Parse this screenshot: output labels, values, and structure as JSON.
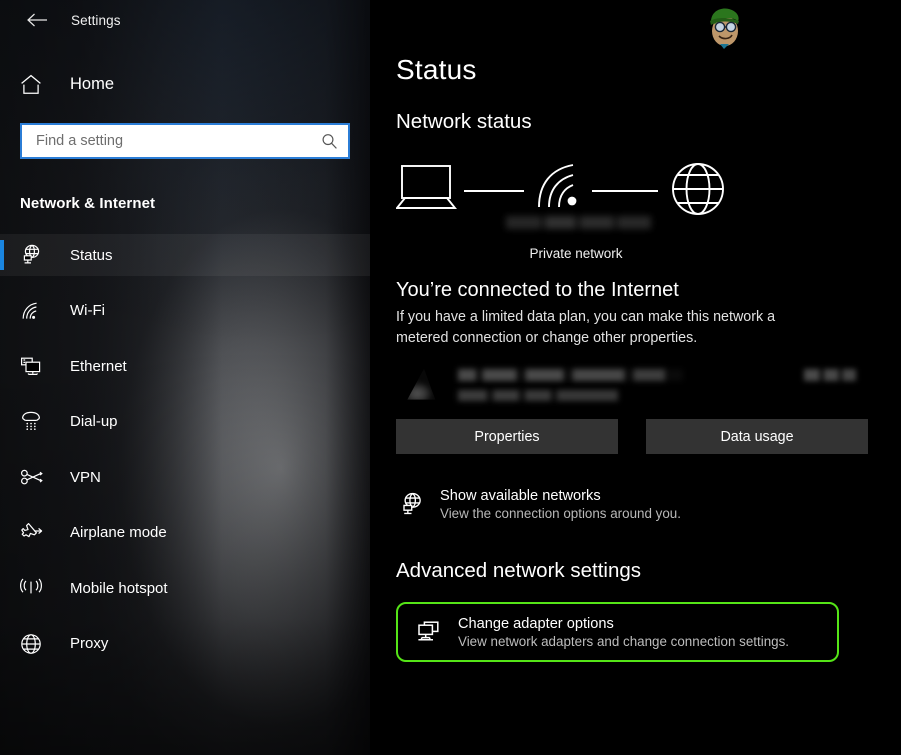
{
  "window": {
    "title": "Settings",
    "back_icon": "back-arrow-icon"
  },
  "sidebar": {
    "home_label": "Home",
    "home_icon": "home-icon",
    "search": {
      "placeholder": "Find a setting",
      "value": "",
      "icon": "search-icon"
    },
    "section_header": "Network & Internet",
    "items": [
      {
        "label": "Status",
        "icon": "network-status-icon",
        "selected": true
      },
      {
        "label": "Wi-Fi",
        "icon": "wifi-icon",
        "selected": false
      },
      {
        "label": "Ethernet",
        "icon": "ethernet-icon",
        "selected": false
      },
      {
        "label": "Dial-up",
        "icon": "dialup-phone-icon",
        "selected": false
      },
      {
        "label": "VPN",
        "icon": "vpn-icon",
        "selected": false
      },
      {
        "label": "Airplane mode",
        "icon": "airplane-icon",
        "selected": false
      },
      {
        "label": "Mobile hotspot",
        "icon": "hotspot-icon",
        "selected": false
      },
      {
        "label": "Proxy",
        "icon": "globe-icon",
        "selected": false
      }
    ]
  },
  "main": {
    "page_title": "Status",
    "network_status_heading": "Network status",
    "diagram": {
      "device_icon": "laptop-icon",
      "router_icon": "wifi-signal-icon",
      "internet_icon": "globe-icon",
      "ssid_label": "",
      "network_type_label": "Private network"
    },
    "connection": {
      "title": "You’re connected to the Internet",
      "description": "If you have a limited data plan, you can make this network a metered connection or change other properties.",
      "network_name": "",
      "network_period": "",
      "data_used": ""
    },
    "buttons": {
      "properties": "Properties",
      "data_usage": "Data usage"
    },
    "show_networks": {
      "icon": "network-status-icon",
      "title": "Show available networks",
      "subtitle": "View the connection options around you."
    },
    "advanced_heading": "Advanced network settings",
    "adapter_options": {
      "icon": "adapter-monitor-icon",
      "title": "Change adapter options",
      "subtitle": "View network adapters and change connection settings.",
      "highlight_color": "#55e417"
    }
  },
  "colors": {
    "accent_blue": "#1a85e0",
    "search_border": "#2b7dd6",
    "button_bg": "#333333",
    "highlight_green": "#55e417",
    "content_bg": "#000000"
  },
  "watermark": {
    "name": "appuals-mascot-logo",
    "cap_color": "#2e7d1f",
    "skin_color": "#c49a6c"
  }
}
